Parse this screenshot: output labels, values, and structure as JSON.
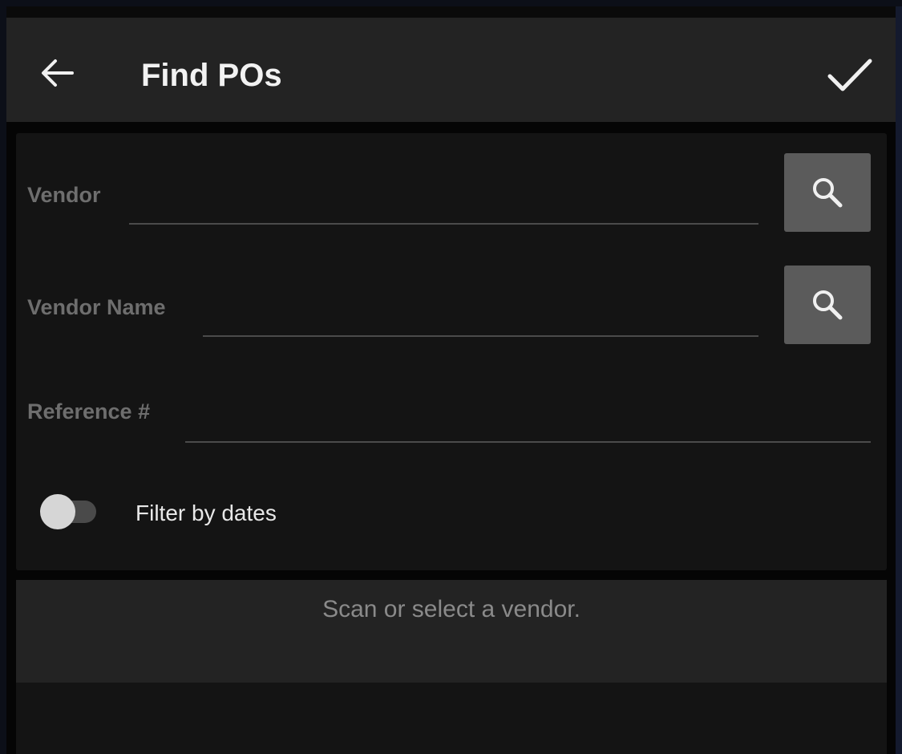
{
  "appbar": {
    "title": "Find POs",
    "back_icon": "arrow-left-icon",
    "confirm_icon": "check-icon"
  },
  "form": {
    "vendor": {
      "label": "Vendor",
      "value": "",
      "search_icon": "search-icon"
    },
    "vendor_name": {
      "label": "Vendor Name",
      "value": "",
      "search_icon": "search-icon"
    },
    "reference": {
      "label": "Reference #",
      "value": ""
    },
    "filter_by_dates": {
      "label": "Filter by dates",
      "enabled": false
    }
  },
  "message": {
    "text": "Scan or select a vendor."
  },
  "colors": {
    "appbar": "#232323",
    "card": "#141414",
    "search_button": "#5b5b5b",
    "label": "#6e6e6e"
  }
}
